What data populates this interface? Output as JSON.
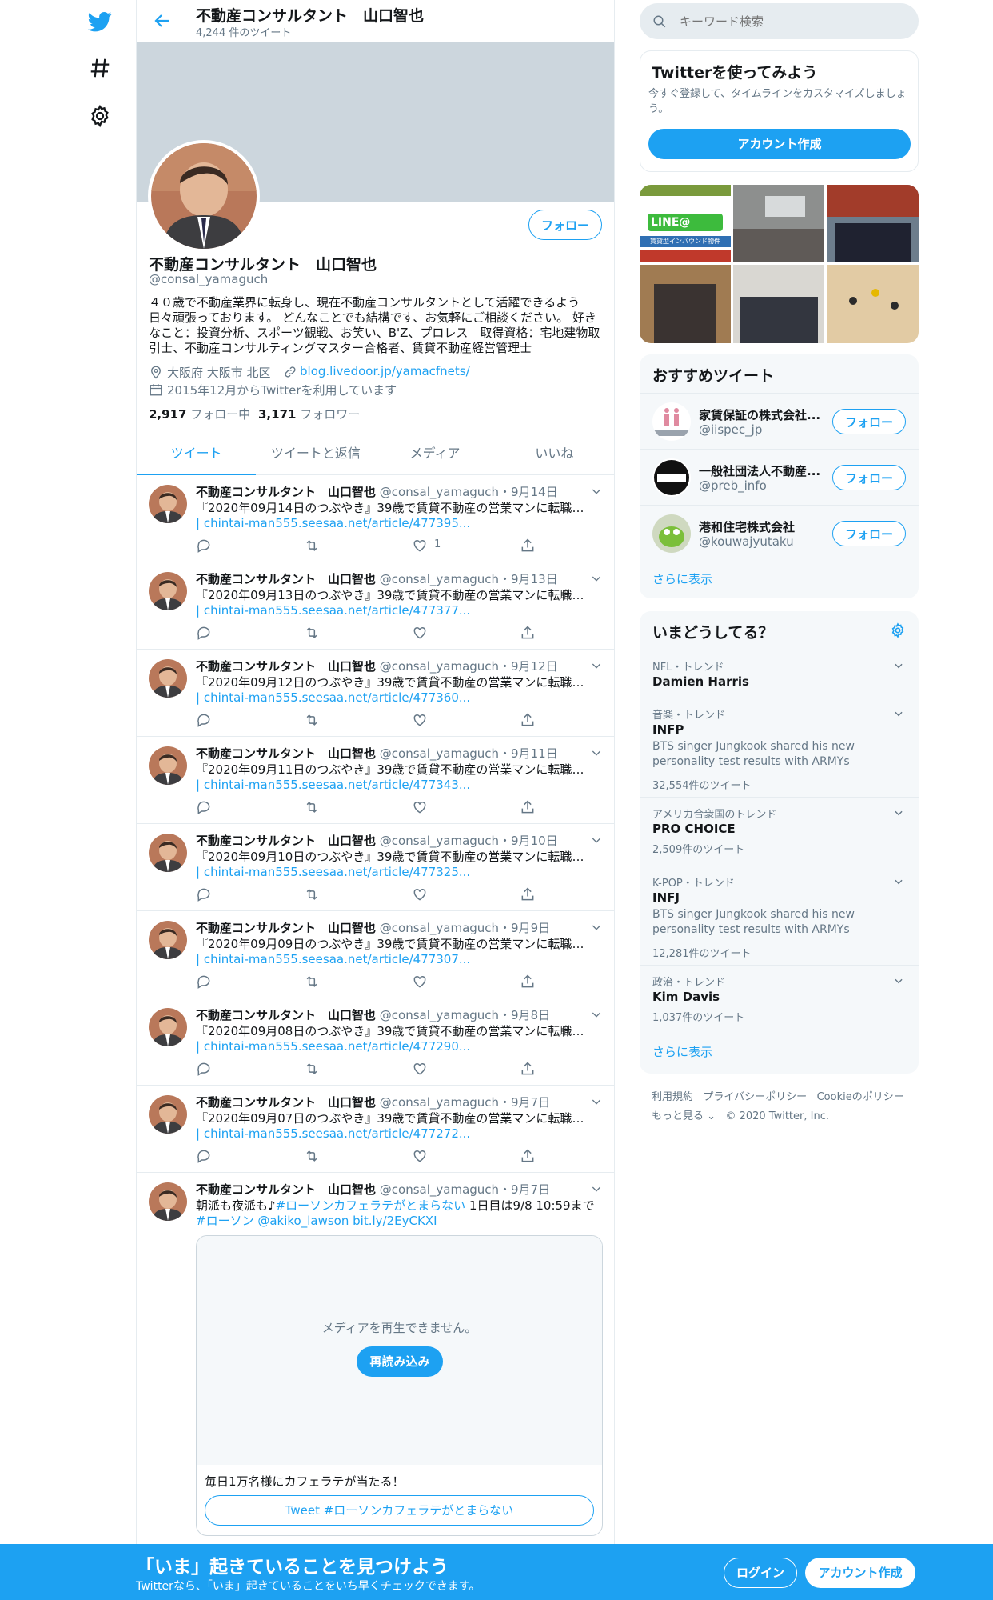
{
  "nav": {
    "logo": "twitter-bird-icon",
    "explore": "hashtag-icon",
    "settings": "gear-icon"
  },
  "header": {
    "title": "不動産コンサルタント　山口智也",
    "tweet_count": "4,244 件のツイート"
  },
  "profile": {
    "name": "不動産コンサルタント　山口智也",
    "handle": "@consal_yamaguch",
    "follow_label": "フォロー",
    "bio": [
      "４０歳で不動産業界に転身し、現在不動産コンサルタントとして活躍できるよう",
      "日々頑張っております。 どんなことでも結構です、お気軽にご相談ください。 好き",
      "なこと：投資分析、スポーツ観戦、お笑い、B'Z、プロレス　取得資格：宅地建物取",
      "引士、不動産コンサルティングマスター合格者、賃貸不動産経営管理士"
    ],
    "location": "大阪府 大阪市 北区",
    "website": "blog.livedoor.jp/yamacfnets/",
    "joined": "2015年12月からTwitterを利用しています",
    "following_count": "2,917",
    "following_label": "フォロー中",
    "followers_count": "3,171",
    "followers_label": "フォロワー"
  },
  "tabs": [
    "ツイート",
    "ツイートと返信",
    "メディア",
    "いいね"
  ],
  "tweets": [
    {
      "name": "不動産コンサルタント　山口智也",
      "meta": "@consal_yamaguch・9月14日",
      "text": "『2020年09月14日のつぶやき』39歳で賃貸不動産の営業マンに転職した...",
      "link": "| chintai-man555.seesaa.net/article/477395...",
      "likes": "1"
    },
    {
      "name": "不動産コンサルタント　山口智也",
      "meta": "@consal_yamaguch・9月13日",
      "text": "『2020年09月13日のつぶやき』39歳で賃貸不動産の営業マンに転職した...",
      "link": "| chintai-man555.seesaa.net/article/477377...",
      "likes": ""
    },
    {
      "name": "不動産コンサルタント　山口智也",
      "meta": "@consal_yamaguch・9月12日",
      "text": "『2020年09月12日のつぶやき』39歳で賃貸不動産の営業マンに転職した...",
      "link": "| chintai-man555.seesaa.net/article/477360...",
      "likes": ""
    },
    {
      "name": "不動産コンサルタント　山口智也",
      "meta": "@consal_yamaguch・9月11日",
      "text": "『2020年09月11日のつぶやき』39歳で賃貸不動産の営業マンに転職した...",
      "link": "| chintai-man555.seesaa.net/article/477343...",
      "likes": ""
    },
    {
      "name": "不動産コンサルタント　山口智也",
      "meta": "@consal_yamaguch・9月10日",
      "text": "『2020年09月10日のつぶやき』39歳で賃貸不動産の営業マンに転職した...",
      "link": "| chintai-man555.seesaa.net/article/477325...",
      "likes": ""
    },
    {
      "name": "不動産コンサルタント　山口智也",
      "meta": "@consal_yamaguch・9月9日",
      "text": "『2020年09月09日のつぶやき』39歳で賃貸不動産の営業マンに転職した...",
      "link": "| chintai-man555.seesaa.net/article/477307...",
      "likes": ""
    },
    {
      "name": "不動産コンサルタント　山口智也",
      "meta": "@consal_yamaguch・9月8日",
      "text": "『2020年09月08日のつぶやき』39歳で賃貸不動産の営業マンに転職した...",
      "link": "| chintai-man555.seesaa.net/article/477290...",
      "likes": ""
    },
    {
      "name": "不動産コンサルタント　山口智也",
      "meta": "@consal_yamaguch・9月7日",
      "text": "『2020年09月07日のつぶやき』39歳で賃貸不動産の営業マンに転職した...",
      "link": "| chintai-man555.seesaa.net/article/477272...",
      "likes": ""
    }
  ],
  "media_tweet": {
    "name": "不動産コンサルタント　山口智也",
    "meta": "@consal_yamaguch・9月7日",
    "text_a": "朝派も夜派も♪",
    "hashtag": "#ローソンカフェラテがとまらない",
    "text_b": " 1日目は9/8 10:59まで ",
    "text_c": "#ローソン",
    "mention": "@akiko_lawson",
    "shortlink": "bit.ly/2EyCKXI",
    "media_error": "メディアを再生できません。",
    "reload_label": "再読み込み",
    "card_text": "毎日1万名様にカフェラテが当たる！",
    "card_button": "Tweet #ローソンカフェラテがとまらない"
  },
  "search": {
    "placeholder": "キーワード検索"
  },
  "signup": {
    "title": "Twitterを使ってみよう",
    "desc": [
      "今すぐ登録して、タイムラインをカスタマイズしましょ",
      "う。"
    ],
    "button": "アカウント作成"
  },
  "media_grid": {
    "tile_line": "LINE@",
    "tile_sub": "賃貸型インバウンド物件"
  },
  "recommend": {
    "title": "おすすめツイート",
    "users": [
      {
        "name": "家賃保証の株式会社...",
        "handle": "@iispec_jp",
        "button": "フォロー"
      },
      {
        "name": "一般社団法人不動産...",
        "handle": "@preb_info",
        "button": "フォロー"
      },
      {
        "name": "港和住宅株式会社",
        "handle": "@kouwajyutaku",
        "button": "フォロー"
      }
    ],
    "more": "さらに表示"
  },
  "trends": {
    "title": "いまどうしてる？",
    "items": [
      {
        "category": "NFL・トレンド",
        "name": "Damien Harris",
        "desc": [
          "",
          ""
        ],
        "count": ""
      },
      {
        "category": "音楽・トレンド",
        "name": "INFP",
        "desc": [
          "BTS singer Jungkook shared his new",
          "personality test results with ARMYs"
        ],
        "count": "32,554件のツイート"
      },
      {
        "category": "アメリカ合衆国のトレンド",
        "name": "PRO CHOICE",
        "desc": [
          "",
          ""
        ],
        "count": "2,509件のツイート"
      },
      {
        "category": "K-POP・トレンド",
        "name": "INFJ",
        "desc": [
          "BTS singer Jungkook shared his new",
          "personality test results with ARMYs"
        ],
        "count": "12,281件のツイート"
      },
      {
        "category": "政治・トレンド",
        "name": "Kim Davis",
        "desc": [
          "",
          ""
        ],
        "count": "1,037件のツイート"
      }
    ],
    "more": "さらに表示"
  },
  "footer": {
    "links": [
      "利用規約",
      "プライバシーポリシー",
      "Cookieのポリシー"
    ],
    "more": "もっと見る",
    "copyright": "© 2020 Twitter, Inc."
  },
  "bottom_bar": {
    "title": "「いま」起きていることを見つけよう",
    "subtitle": "Twitterなら、「いま」起きていることをいち早くチェックできます。",
    "login": "ログイン",
    "signup": "アカウント作成"
  },
  "colors": {
    "accent": "#1da1f2",
    "text": "#14171a",
    "secondary": "#657786",
    "banner": "#ccd6dd",
    "panel": "#f5f8fa"
  }
}
